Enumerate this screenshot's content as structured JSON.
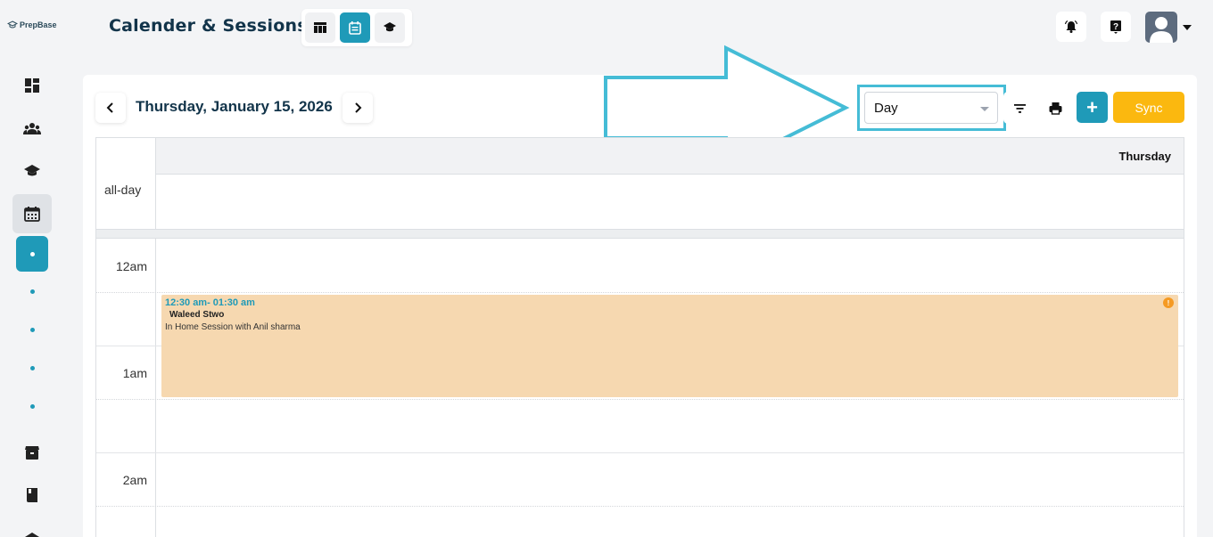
{
  "brand": {
    "logo_text": "PrepBase"
  },
  "sidebar": {
    "items": [
      {
        "icon": "dashboard-icon"
      },
      {
        "icon": "users-icon"
      },
      {
        "icon": "graduation-cap-icon"
      },
      {
        "icon": "calendar-icon",
        "active": true
      },
      {
        "icon": "archive-box-icon"
      },
      {
        "icon": "book-icon"
      },
      {
        "icon": "school-icon"
      }
    ],
    "sub_items_count": 5
  },
  "header": {
    "title": "Calender & Sessions",
    "view_switch": [
      "table-view-icon",
      "calendar-view-icon",
      "graduation-cap-icon"
    ],
    "actions": [
      "notification-bell-icon",
      "help-icon",
      "avatar"
    ]
  },
  "toolbar": {
    "current_date": "Thursday, January 15, 2026",
    "view_select_value": "Day",
    "add_label": "+",
    "sync_label": "Sync"
  },
  "calendar": {
    "day_header": "Thursday",
    "all_day_label": "all-day",
    "time_labels": [
      "12am",
      "1am",
      "2am"
    ],
    "events": [
      {
        "time": "12:30 am- 01:30 am",
        "name": "Waleed Stwo",
        "description": "In Home Session with Anil sharma",
        "alert": "!"
      }
    ]
  },
  "colors": {
    "accent": "#1f9ab8",
    "sync": "#fbb80f",
    "event_bg": "#f6d8b0",
    "highlight": "#45bcd6"
  }
}
